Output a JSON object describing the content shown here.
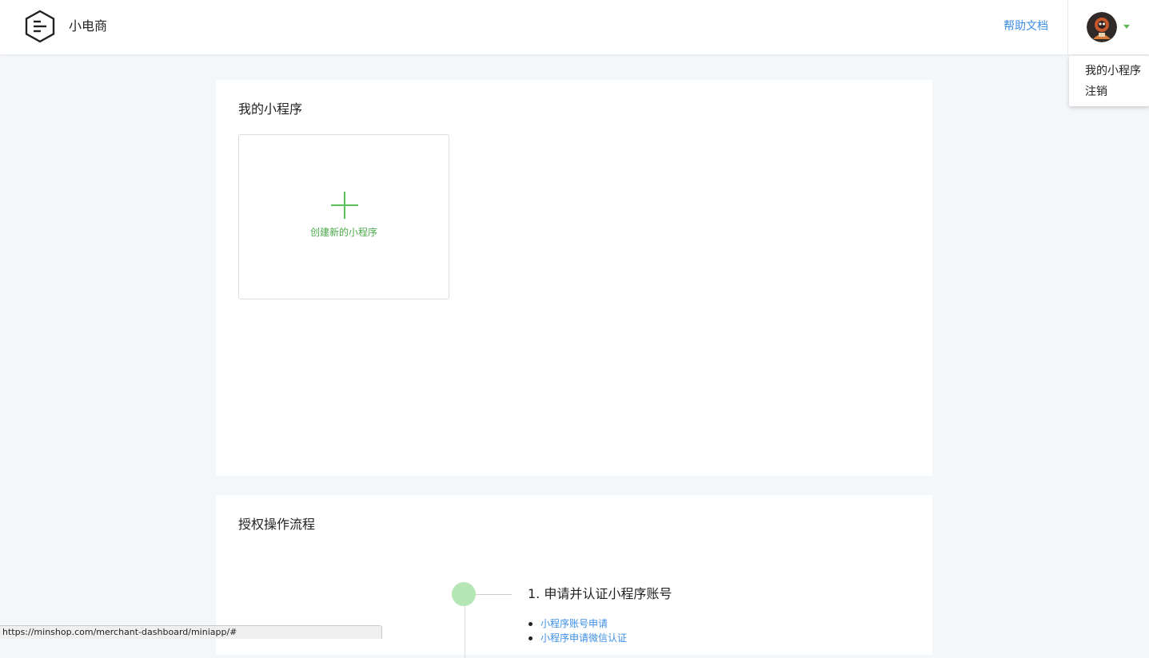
{
  "header": {
    "brand": "小电商",
    "help_link": "帮助文档"
  },
  "user_menu": {
    "items": [
      "我的小程序",
      "注销"
    ]
  },
  "my_miniapps": {
    "title": "我的小程序",
    "create_label": "创建新的小程序"
  },
  "auth_flow": {
    "title": "授权操作流程",
    "steps": [
      {
        "title": "1. 申请并认证小程序账号",
        "links": [
          "小程序账号申请",
          "小程序申请微信认证"
        ]
      }
    ]
  },
  "status_bar": {
    "url": "https://minshop.com/merchant-dashboard/miniapp/#"
  },
  "colors": {
    "accent_green": "#5ac15a",
    "link_blue": "#3d8ee6",
    "page_background": "#f4f7fa"
  }
}
